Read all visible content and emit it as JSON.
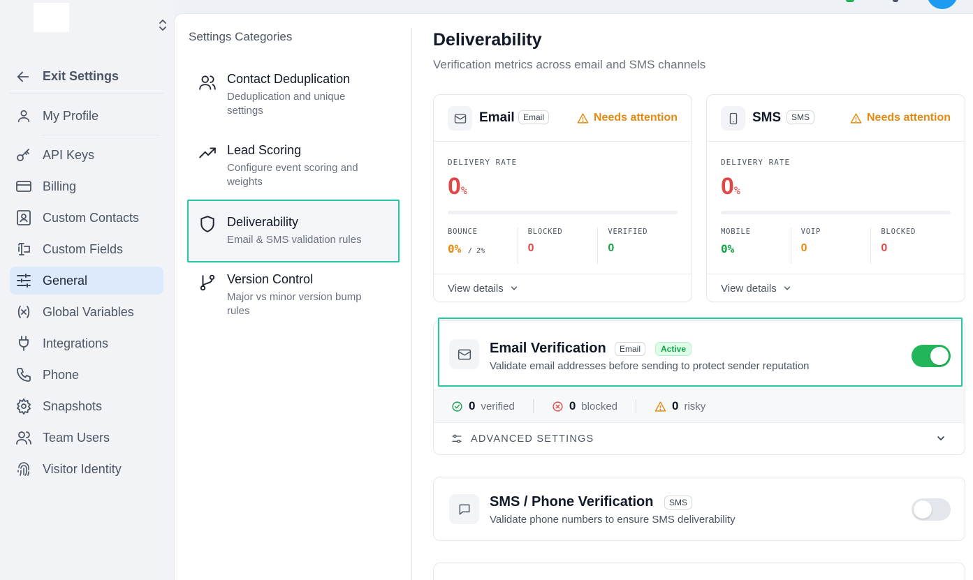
{
  "sidebar": {
    "exit_label": "Exit Settings",
    "items": [
      {
        "label": "My Profile",
        "icon": "user-icon"
      },
      {
        "label": "API Keys",
        "icon": "key-icon"
      },
      {
        "label": "Billing",
        "icon": "credit-card-icon"
      },
      {
        "label": "Custom Contacts",
        "icon": "contact-card-icon"
      },
      {
        "label": "Custom Fields",
        "icon": "text-cursor-input-icon"
      },
      {
        "label": "General",
        "icon": "sliders-icon",
        "active": true
      },
      {
        "label": "Global Variables",
        "icon": "variable-icon"
      },
      {
        "label": "Integrations",
        "icon": "plug-icon"
      },
      {
        "label": "Phone",
        "icon": "phone-icon"
      },
      {
        "label": "Snapshots",
        "icon": "gear-icon"
      },
      {
        "label": "Team Users",
        "icon": "users-icon"
      },
      {
        "label": "Visitor Identity",
        "icon": "fingerprint-icon"
      }
    ]
  },
  "categories": {
    "title": "Settings Categories",
    "items": [
      {
        "title": "Contact Deduplication",
        "desc": "Deduplication and unique settings",
        "icon": "users-icon"
      },
      {
        "title": "Lead Scoring",
        "desc": "Configure event scoring and weights",
        "icon": "trending-up-icon"
      },
      {
        "title": "Deliverability",
        "desc": "Email & SMS validation rules",
        "icon": "shield-icon",
        "selected": true
      },
      {
        "title": "Version Control",
        "desc": "Major vs minor version bump rules",
        "icon": "git-branch-icon"
      }
    ]
  },
  "page": {
    "title": "Deliverability",
    "subtitle": "Verification metrics across email and SMS channels"
  },
  "email_card": {
    "name": "Email",
    "tag": "Email",
    "status": "Needs attention",
    "rate_label": "DELIVERY RATE",
    "rate_value": "0",
    "rate_unit": "%",
    "stats": [
      {
        "label": "BOUNCE",
        "value": "0%",
        "extra": "/ 2%"
      },
      {
        "label": "BLOCKED",
        "value": "0"
      },
      {
        "label": "VERIFIED",
        "value": "0"
      }
    ],
    "details_label": "View details"
  },
  "sms_card": {
    "name": "SMS",
    "tag": "SMS",
    "status": "Needs attention",
    "rate_label": "DELIVERY RATE",
    "rate_value": "0",
    "rate_unit": "%",
    "stats": [
      {
        "label": "MOBILE",
        "value": "0%"
      },
      {
        "label": "VOIP",
        "value": "0"
      },
      {
        "label": "BLOCKED",
        "value": "0"
      }
    ],
    "details_label": "View details"
  },
  "email_verification": {
    "title": "Email Verification",
    "tag": "Email",
    "status": "Active",
    "desc": "Validate email addresses before sending to protect sender reputation",
    "enabled": true,
    "stats": [
      {
        "value": "0",
        "label": "verified"
      },
      {
        "value": "0",
        "label": "blocked"
      },
      {
        "value": "0",
        "label": "risky"
      }
    ],
    "advanced_label": "ADVANCED SETTINGS"
  },
  "sms_verification": {
    "title": "SMS / Phone Verification",
    "tag": "SMS",
    "desc": "Validate phone numbers to ensure SMS deliverability",
    "enabled": false
  },
  "colors": {
    "accent_highlight": "#2ec4a5",
    "active_nav_bg": "#dceafb",
    "warning": "#e58a11",
    "danger": "#e04848",
    "success": "#16a34a",
    "toggle_on": "#22b55a"
  }
}
